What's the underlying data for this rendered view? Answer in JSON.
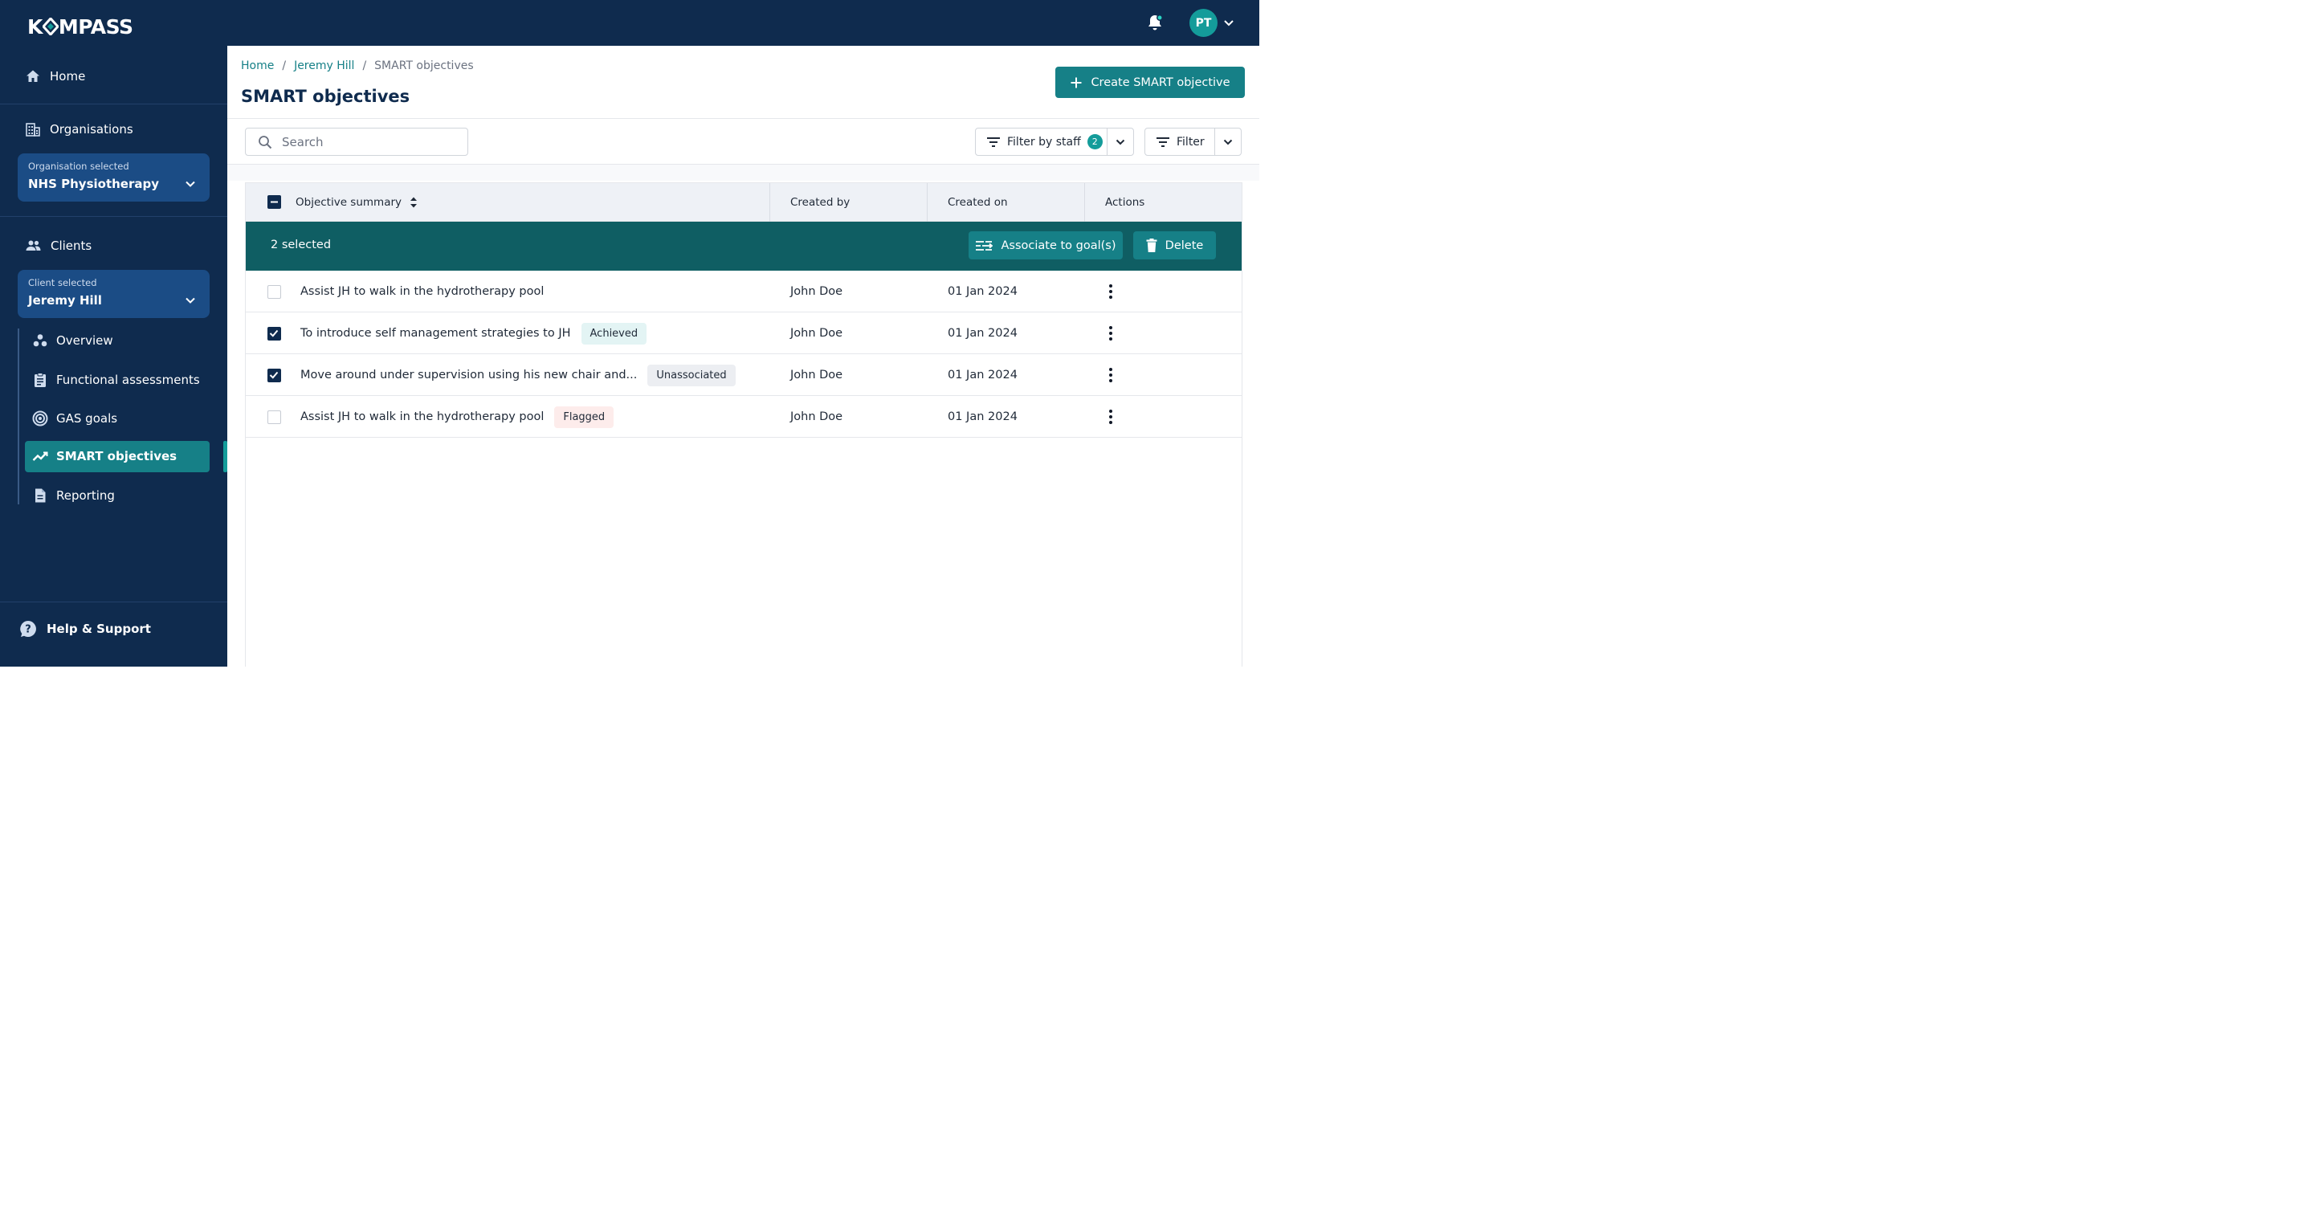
{
  "app": {
    "logo_text_left": "K",
    "logo_text_right": "MPASS",
    "user_initials": "PT"
  },
  "sidebar": {
    "home": "Home",
    "organisations": "Organisations",
    "org_selector": {
      "caption": "Organisation selected",
      "value": "NHS Physiotherapy"
    },
    "clients": "Clients",
    "client_selector": {
      "caption": "Client selected",
      "value": "Jeremy Hill"
    },
    "sub_items": [
      {
        "label": "Overview",
        "icon": "overview-icon"
      },
      {
        "label": "Functional assessments",
        "icon": "clipboard-icon"
      },
      {
        "label": "GAS goals",
        "icon": "target-icon"
      },
      {
        "label": "SMART objectives",
        "icon": "trend-icon",
        "active": true
      },
      {
        "label": "Reporting",
        "icon": "document-icon"
      }
    ],
    "help": "Help & Support"
  },
  "header": {
    "breadcrumb": [
      "Home",
      "Jeremy Hill",
      "SMART objectives"
    ],
    "breadcrumb_sep": "/",
    "title": "SMART objectives",
    "create_button": "Create SMART objective"
  },
  "toolbar": {
    "search_placeholder": "Search",
    "filter_by_staff": "Filter by staff",
    "filter_by_staff_count": "2",
    "filter": "Filter"
  },
  "table": {
    "columns": [
      "Objective summary",
      "Created by",
      "Created on",
      "Actions"
    ],
    "selection": {
      "text": "2 selected",
      "associate_button": "Associate to goal(s)",
      "delete_button": "Delete"
    },
    "rows": [
      {
        "checked": false,
        "summary": "Assist JH to walk in the hydrotherapy pool",
        "tag": "",
        "created_by": "John Doe",
        "created_on": "01 Jan 2024"
      },
      {
        "checked": true,
        "summary": "To introduce self management strategies to JH",
        "tag": "Achieved",
        "created_by": "John Doe",
        "created_on": "01 Jan 2024"
      },
      {
        "checked": true,
        "summary": "Move around under supervision using his new chair and...",
        "tag": "Unassociated",
        "created_by": "John Doe",
        "created_on": "01 Jan 2024"
      },
      {
        "checked": false,
        "summary": "Assist JH to walk in the hydrotherapy pool",
        "tag": "Flagged",
        "created_by": "John Doe",
        "created_on": "01 Jan 2024"
      }
    ]
  },
  "colors": {
    "navy": "#0f2b4e",
    "teal": "#168087",
    "teal_dark": "#0f5e63",
    "selector_blue": "#1b4c85"
  }
}
